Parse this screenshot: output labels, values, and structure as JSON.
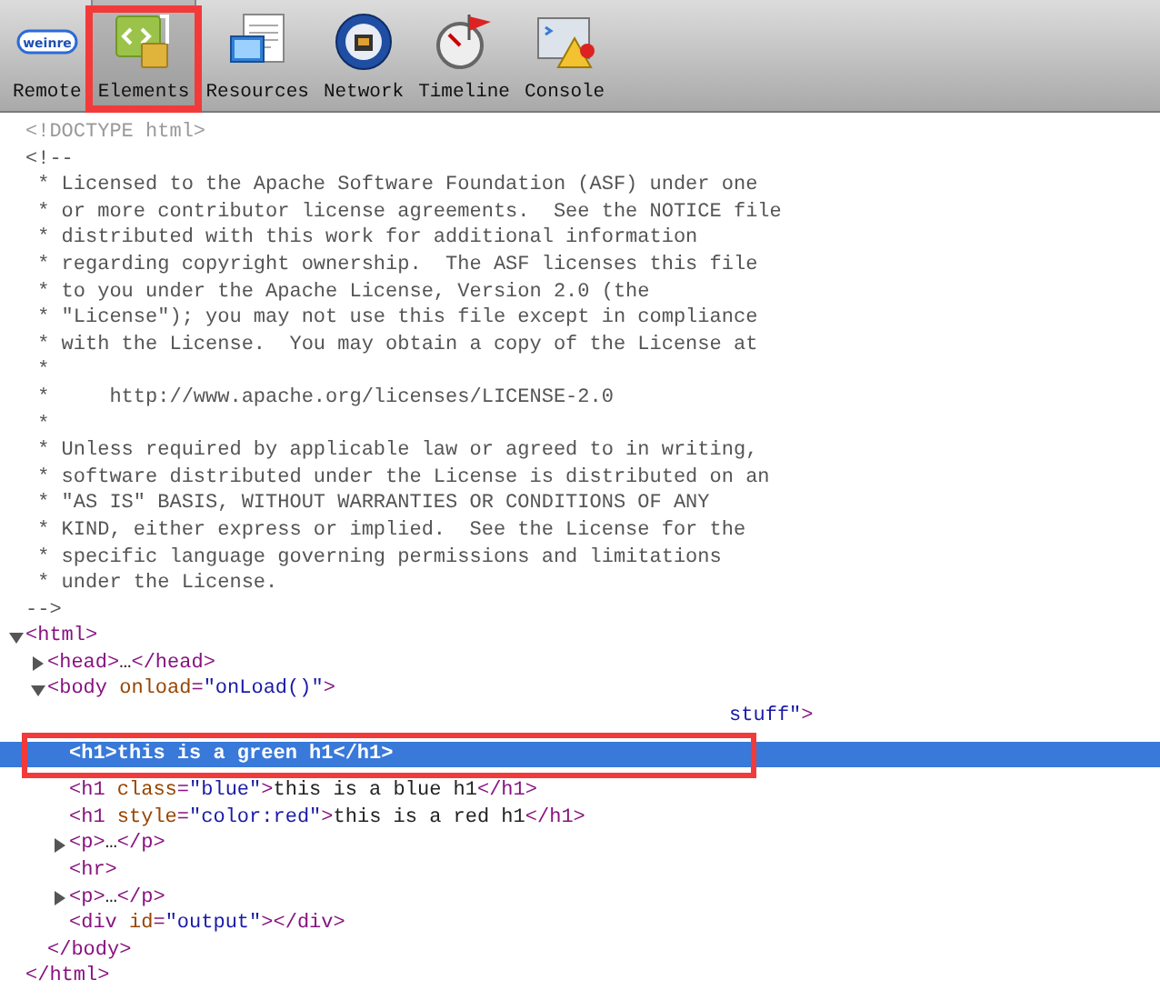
{
  "toolbar": {
    "tools": [
      {
        "label": "Remote",
        "kind": "logo",
        "logo_text": "weinre",
        "selected": false
      },
      {
        "label": "Elements",
        "kind": "elements",
        "selected": true
      },
      {
        "label": "Resources",
        "kind": "resources",
        "selected": false
      },
      {
        "label": "Network",
        "kind": "network",
        "selected": false
      },
      {
        "label": "Timeline",
        "kind": "timeline",
        "selected": false
      },
      {
        "label": "Console",
        "kind": "console",
        "selected": false
      }
    ]
  },
  "tree": [
    {
      "kind": "doctype",
      "text": "<!DOCTYPE html>"
    },
    {
      "kind": "comment",
      "lines": [
        "<!--",
        " * Licensed to the Apache Software Foundation (ASF) under one",
        " * or more contributor license agreements.  See the NOTICE file",
        " * distributed with this work for additional information",
        " * regarding copyright ownership.  The ASF licenses this file",
        " * to you under the Apache License, Version 2.0 (the",
        " * \"License\"); you may not use this file except in compliance",
        " * with the License.  You may obtain a copy of the License at",
        " *",
        " *     http://www.apache.org/licenses/LICENSE-2.0",
        " *",
        " * Unless required by applicable law or agreed to in writing,",
        " * software distributed under the License is distributed on an",
        " * \"AS IS\" BASIS, WITHOUT WARRANTIES OR CONDITIONS OF ANY",
        " * KIND, either express or implied.  See the License for the",
        " * specific language governing permissions and limitations",
        " * under the License.",
        "-->"
      ]
    },
    {
      "kind": "element",
      "expanded": true,
      "selected": false,
      "open": [
        {
          "kind": "tag",
          "text": "<html>"
        }
      ],
      "close": [
        {
          "kind": "tag",
          "text": "</html>"
        }
      ],
      "children": [
        {
          "kind": "element",
          "expanded": false,
          "selected": false,
          "open": [
            {
              "kind": "tag",
              "text": "<head>"
            },
            {
              "kind": "plain",
              "text": "…"
            },
            {
              "kind": "tag",
              "text": "</head>"
            }
          ]
        },
        {
          "kind": "element",
          "expanded": true,
          "selected": false,
          "open": [
            {
              "kind": "tag",
              "text": "<body "
            },
            {
              "kind": "attr",
              "text": "onload"
            },
            {
              "kind": "tag",
              "text": "="
            },
            {
              "kind": "val",
              "text": "\"onLoad()\""
            },
            {
              "kind": "tag",
              "text": ">"
            }
          ],
          "close": [
            {
              "kind": "tag",
              "text": "</body>"
            }
          ],
          "children": [
            {
              "kind": "fragment",
              "selected": false,
              "open": [
                {
                  "kind": "val",
                  "text": "stuff\""
                },
                {
                  "kind": "tag",
                  "text": ">"
                }
              ]
            },
            {
              "kind": "element",
              "selected": true,
              "open": [
                {
                  "kind": "tag",
                  "text": "<h1>"
                },
                {
                  "kind": "plain",
                  "text": "this is a green h1"
                },
                {
                  "kind": "tag",
                  "text": "</h1>"
                }
              ]
            },
            {
              "kind": "element",
              "selected": false,
              "open": [
                {
                  "kind": "tag",
                  "text": "<h1 "
                },
                {
                  "kind": "attr",
                  "text": "class"
                },
                {
                  "kind": "tag",
                  "text": "="
                },
                {
                  "kind": "val",
                  "text": "\"blue\""
                },
                {
                  "kind": "tag",
                  "text": ">"
                },
                {
                  "kind": "plain",
                  "text": "this is a blue h1"
                },
                {
                  "kind": "tag",
                  "text": "</h1>"
                }
              ]
            },
            {
              "kind": "element",
              "selected": false,
              "open": [
                {
                  "kind": "tag",
                  "text": "<h1 "
                },
                {
                  "kind": "attr",
                  "text": "style"
                },
                {
                  "kind": "tag",
                  "text": "="
                },
                {
                  "kind": "val",
                  "text": "\"color:red\""
                },
                {
                  "kind": "tag",
                  "text": ">"
                },
                {
                  "kind": "plain",
                  "text": "this is a red h1"
                },
                {
                  "kind": "tag",
                  "text": "</h1>"
                }
              ]
            },
            {
              "kind": "element",
              "expanded": false,
              "selected": false,
              "open": [
                {
                  "kind": "tag",
                  "text": "<p>"
                },
                {
                  "kind": "plain",
                  "text": "…"
                },
                {
                  "kind": "tag",
                  "text": "</p>"
                }
              ]
            },
            {
              "kind": "element",
              "selected": false,
              "open": [
                {
                  "kind": "tag",
                  "text": "<hr>"
                }
              ]
            },
            {
              "kind": "element",
              "expanded": false,
              "selected": false,
              "open": [
                {
                  "kind": "tag",
                  "text": "<p>"
                },
                {
                  "kind": "plain",
                  "text": "…"
                },
                {
                  "kind": "tag",
                  "text": "</p>"
                }
              ]
            },
            {
              "kind": "element",
              "selected": false,
              "open": [
                {
                  "kind": "tag",
                  "text": "<div "
                },
                {
                  "kind": "attr",
                  "text": "id"
                },
                {
                  "kind": "tag",
                  "text": "="
                },
                {
                  "kind": "val",
                  "text": "\"output\""
                },
                {
                  "kind": "tag",
                  "text": "></div>"
                }
              ]
            }
          ]
        }
      ]
    }
  ]
}
